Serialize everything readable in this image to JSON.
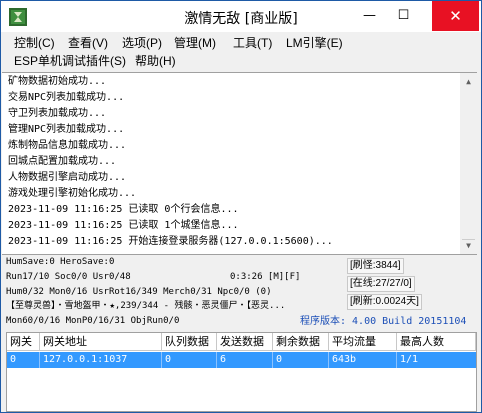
{
  "window": {
    "title": "激情无敌 [商业版]",
    "minimize_glyph": "—",
    "maximize_glyph": "☐",
    "close_glyph": "✕",
    "app_icon": "green-square-app-icon"
  },
  "menu": {
    "items": [
      "控制(C)",
      "查看(V)",
      "选项(P)",
      "管理(M)",
      "工具(T)",
      "LM引擎(E)",
      "ESP单机调试插件(S)",
      "帮助(H)"
    ]
  },
  "log": {
    "lines": [
      "矿物数据初始成功...",
      "交易NPC列表加载成功...",
      "守卫列表加载成功...",
      "管理NPC列表加载成功...",
      "炼制物品信息加载成功...",
      "回城点配置加载成功...",
      "人物数据引擎启动成功...",
      "游戏处理引擎初始化成功...",
      "2023-11-09 11:16:25 已读取 0个行会信息...",
      "2023-11-09 11:16:25 已读取 1个城堡信息...",
      "2023-11-09 11:16:25 开始连接登录服务器(127.0.0.1:5600)..."
    ]
  },
  "status": {
    "line1": "HumSave:0 HeroSave:0",
    "line2": "Run17/10 Soc0/0 Usr0/48",
    "runtime": "0:3:26 [M][F]",
    "line3": "Hum0/32 Mon0/16 UsrRot16/349 Merch0/31 Npc0/0 (0)",
    "line4": "【至尊灵兽】・雪地盔甲・★,239/344 - 残骸・恶灵僵尸・【恶灵...",
    "line5": "Mon60/0/16 MonP0/16/31 ObjRun0/0",
    "refresh_monsters": "[刷怪:3844]",
    "online": "[在线:27/27/0]",
    "refresh_time": "[刷新:0.0024天]",
    "version": "程序版本: 4.00 Build 20151104"
  },
  "table": {
    "columns": [
      "网关",
      "网关地址",
      "队列数据",
      "发送数据",
      "剩余数据",
      "平均流量",
      "最高人数"
    ],
    "rows": [
      [
        "0",
        "127.0.0.1:1037",
        "0",
        "6",
        "0",
        "643b",
        "1/1"
      ]
    ]
  },
  "colors": {
    "selection": "#3399ff",
    "version_text": "#1c4fb7",
    "close_button": "#e81123"
  }
}
